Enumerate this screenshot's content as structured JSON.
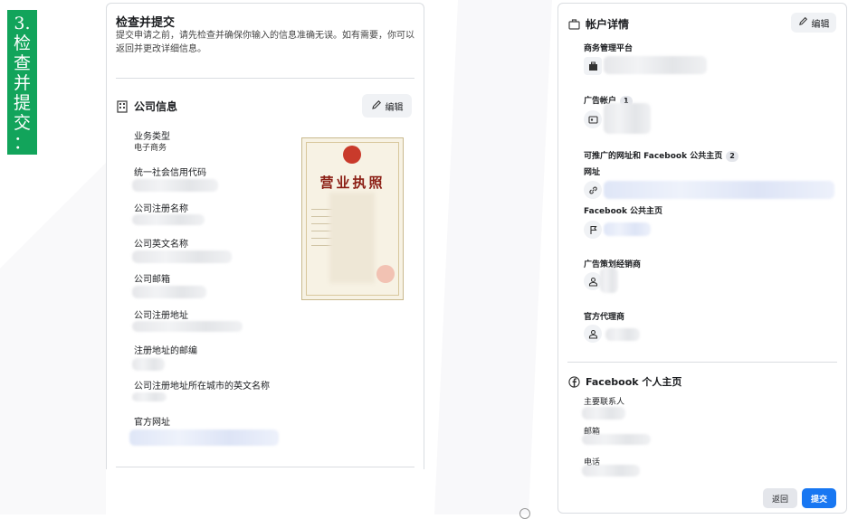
{
  "step": {
    "number": "3.",
    "chars": [
      "检",
      "查",
      "并",
      "提",
      "交",
      "："
    ]
  },
  "review": {
    "title": "检查并提交",
    "description_line1": "提交申请之前，请先检查并确保你输入的信息准确无误。如有需要，你可以",
    "description_line2": "返回并更改详细信息。"
  },
  "company": {
    "title": "公司信息",
    "edit_label": "编辑",
    "fields": {
      "business_type_label": "业务类型",
      "business_type_value": "电子商务",
      "credit_code_label": "统一社会信用代码",
      "reg_name_label": "公司注册名称",
      "en_name_label": "公司英文名称",
      "email_label": "公司邮箱",
      "address_label": "公司注册地址",
      "zip_label": "注册地址的邮编",
      "city_en_label": "公司注册地址所在城市的英文名称",
      "website_label": "官方网址"
    },
    "license": {
      "title": "营业执照"
    }
  },
  "account": {
    "title": "帐户详情",
    "edit_label": "编辑",
    "business_manager_label": "商务管理平台",
    "ad_accounts_label": "广告帐户",
    "ad_accounts_count": "1",
    "promotable_label": "可推广的网址和 Facebook 公共主页",
    "promotable_count": "2",
    "url_label": "网址",
    "fb_page_label": "Facebook 公共主页",
    "ad_reseller_label": "广告策划经销商",
    "agency_label": "官方代理商"
  },
  "fb_profile": {
    "title": "Facebook 个人主页",
    "contact_label": "主要联系人",
    "email_label": "邮箱",
    "phone_label": "电话"
  },
  "footer": {
    "back_label": "返回",
    "submit_label": "提交"
  },
  "colors": {
    "accent": "#1877f2",
    "step_green": "#12a45b"
  }
}
